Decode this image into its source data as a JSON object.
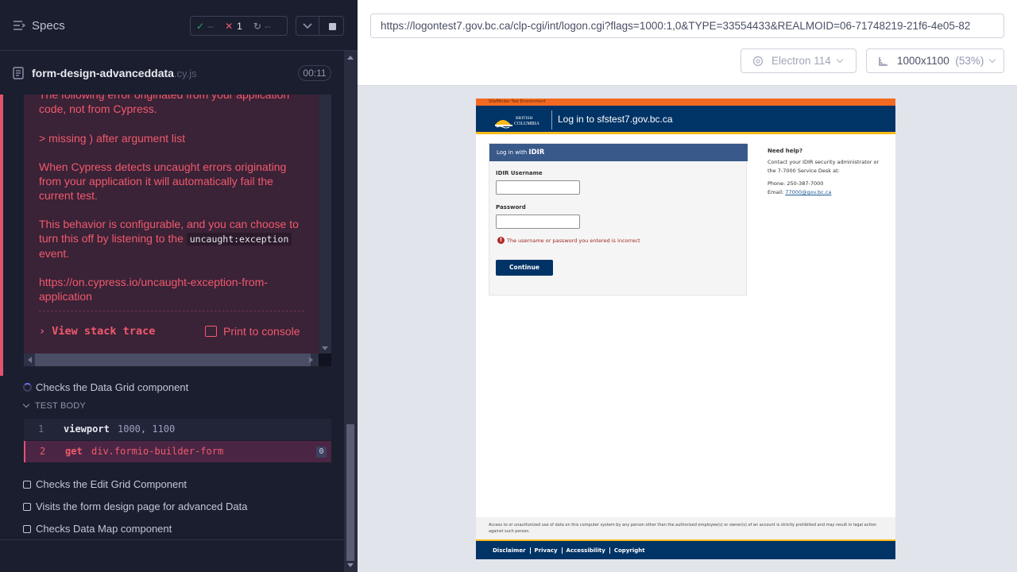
{
  "reporter": {
    "specs_label": "Specs",
    "stats": {
      "passed": "--",
      "failed": "1",
      "pending": "--"
    },
    "spec_file": {
      "name": "form-design-advanceddata",
      "ext": ".cy.js",
      "duration": "00:11"
    },
    "error": {
      "line1": "The following error originated from your application code, not from Cypress.",
      "line2": "> missing ) after argument list",
      "line3": "When Cypress detects uncaught errors originating from your application it will automatically fail the current test.",
      "line4_pre": "This behavior is configurable, and you can choose to turn this off by listening to the",
      "line4_code": "uncaught:exception",
      "line4_post": "event.",
      "link": "https://on.cypress.io/uncaught-exception-from-application",
      "stack_trace_label": "View stack trace",
      "print_console_label": "Print to console"
    },
    "tests": [
      {
        "title": "Checks the Data Grid component",
        "state": "running"
      },
      {
        "title": "Checks the Edit Grid Component",
        "state": "pending"
      },
      {
        "title": "Visits the form design page for advanced Data",
        "state": "pending"
      },
      {
        "title": "Checks Data Map component",
        "state": "pending"
      }
    ],
    "test_body_label": "TEST BODY",
    "commands": [
      {
        "num": "1",
        "name": "viewport",
        "arg": "1000, 1100"
      },
      {
        "num": "2",
        "name": "get",
        "arg": "div.formio-builder-form",
        "count": "0"
      }
    ]
  },
  "aut": {
    "url": "https://logontest7.gov.bc.ca/clp-cgi/int/logon.cgi?flags=1000:1,0&TYPE=33554433&REALMOID=06-71748219-21f6-4e05-82",
    "browser": "Electron 114",
    "viewport": "1000x1100",
    "zoom": "(53%)"
  },
  "app": {
    "env_banner": "SiteMinder Test Environment",
    "logo_line1": "BRITISH",
    "logo_line2": "COLUMBIA",
    "title": "Log in to sfstest7.gov.bc.ca",
    "card_header_pre": "Log in with",
    "card_header_bold": "IDIR",
    "username_label": "IDIR Username",
    "password_label": "Password",
    "error_message": "The username or password you entered is incorrect",
    "continue_label": "Continue",
    "help_title": "Need help?",
    "help_text": "Contact your IDIR security administrator or the 7-7000 Service Desk at:",
    "help_phone": "Phone: 250-387-7000",
    "help_email_pre": "Email:",
    "help_email": "77000@gov.bc.ca",
    "disclaimer": "Access to or unauthorized use of data on this computer system by any person other than the authorized employee(s) or owner(s) of an account is strictly prohibited and may result in legal action against such person.",
    "footer_links": [
      "Disclaimer",
      "Privacy",
      "Accessibility",
      "Copyright"
    ]
  },
  "colors": {
    "reporter_bg": "#1b1e2e",
    "fail_red": "#f15a6c",
    "pass_green": "#1fa971",
    "bc_blue": "#003366",
    "bc_gold": "#fcba19",
    "env_orange": "#f26a21"
  },
  "icons": [
    "specs-list-icon",
    "file-icon",
    "check-icon",
    "x-icon",
    "pending-icon",
    "chevron-down-icon",
    "stop-icon",
    "console-icon",
    "spinner-icon",
    "browser-icon",
    "ruler-icon",
    "error-circle-icon"
  ]
}
